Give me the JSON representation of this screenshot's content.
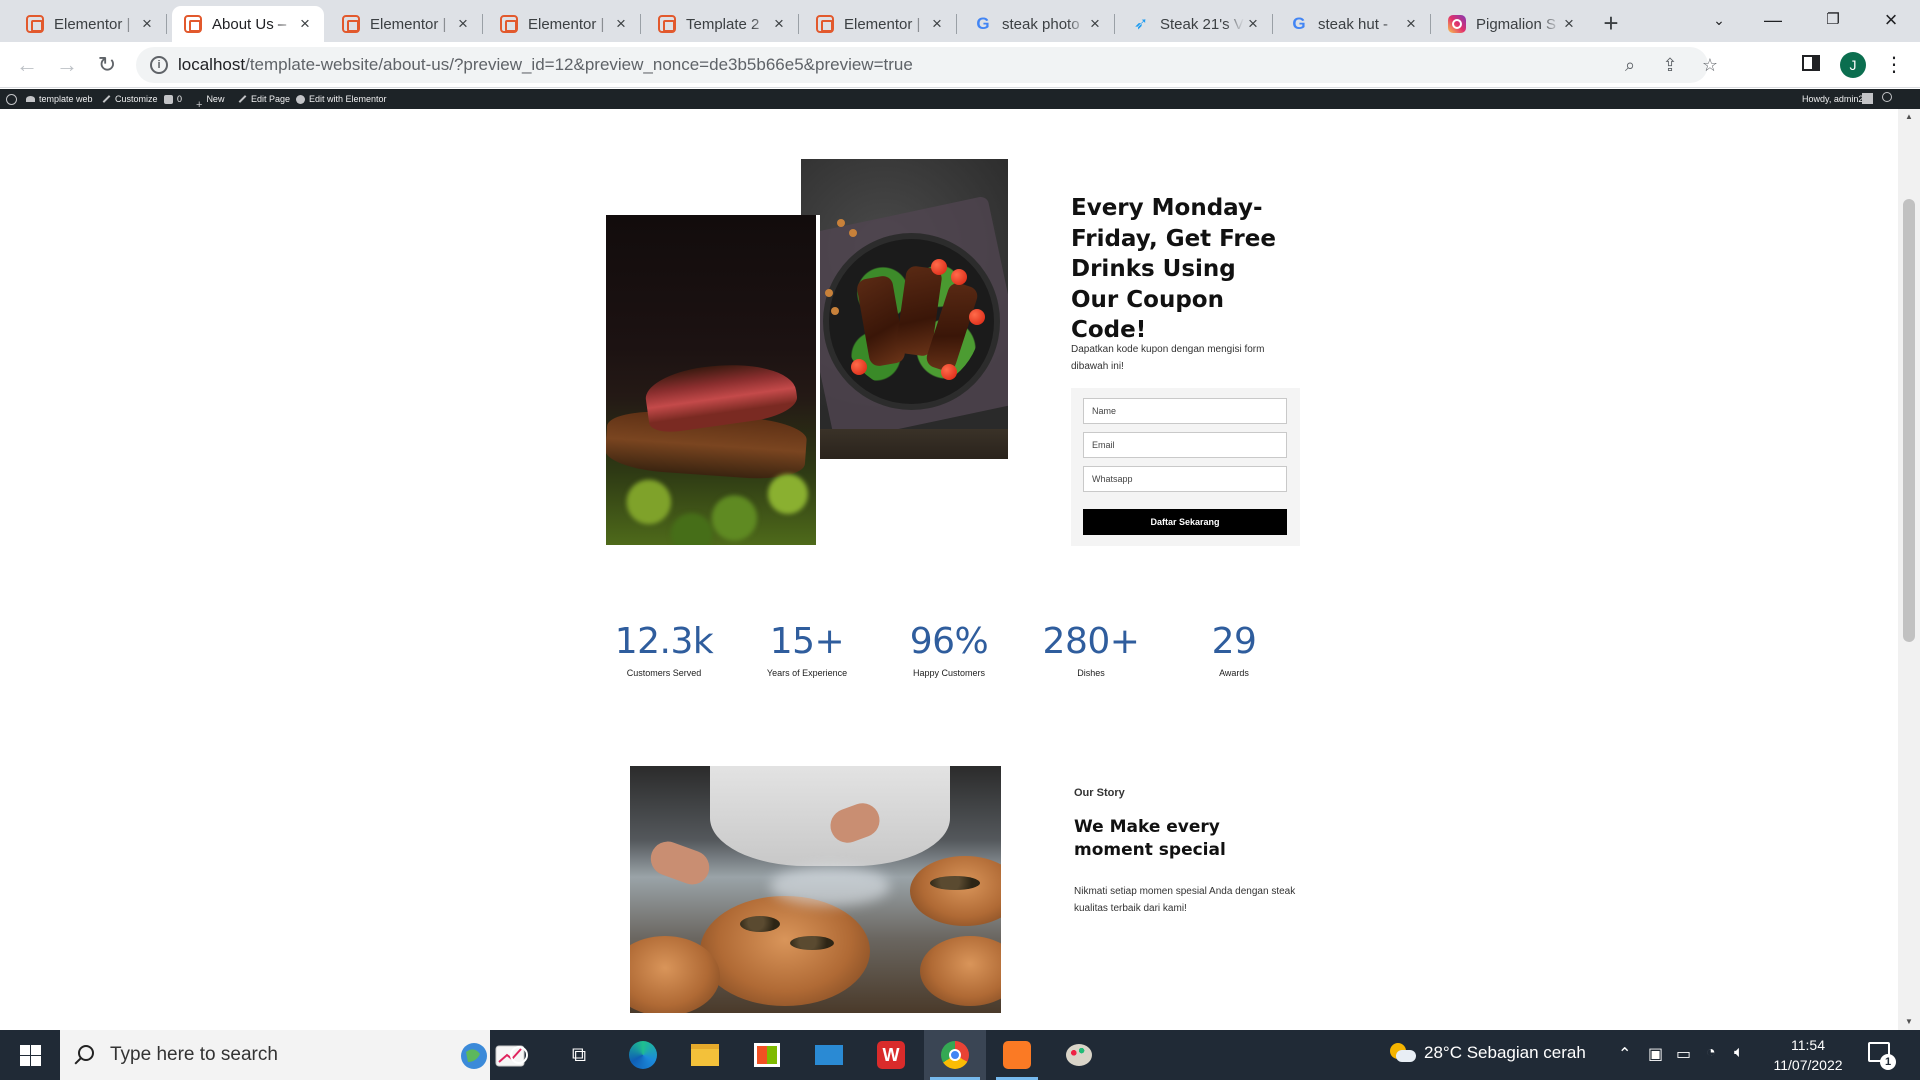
{
  "browser": {
    "tabs": [
      {
        "title": "Elementor | ",
        "icon": "elementor-icon",
        "active": false
      },
      {
        "title": "About Us – ",
        "icon": "elementor-icon",
        "active": true
      },
      {
        "title": "Elementor | ",
        "icon": "elementor-icon",
        "active": false
      },
      {
        "title": "Elementor | ",
        "icon": "elementor-icon",
        "active": false
      },
      {
        "title": "Template 2 ",
        "icon": "elementor-icon",
        "active": false
      },
      {
        "title": "Elementor | ",
        "icon": "elementor-icon",
        "active": false
      },
      {
        "title": "steak photo",
        "icon": "google-icon",
        "active": false
      },
      {
        "title": "Steak 21's V",
        "icon": "bird-icon",
        "active": false
      },
      {
        "title": "steak hut - ",
        "icon": "google-icon",
        "active": false
      },
      {
        "title": "Pigmalion S",
        "icon": "instagram-icon",
        "active": false
      }
    ],
    "url": {
      "host": "localhost",
      "path": "/template-website/about-us/?preview_id=12&preview_nonce=de3b5b66e5&preview=true"
    },
    "profile_initial": "J"
  },
  "adminbar": {
    "items": [
      "template web",
      "Customize",
      "0",
      "New",
      "Edit Page",
      "Edit with Elementor"
    ],
    "howdy": "Howdy, admin2"
  },
  "promo": {
    "heading": "Every Monday-Friday, Get Free Drinks Using Our Coupon Code!",
    "subtext": "Dapatkan kode kupon dengan mengisi form dibawah ini!",
    "form": {
      "name_placeholder": "Name",
      "email_placeholder": "Email",
      "whatsapp_placeholder": "Whatsapp",
      "submit_label": "Daftar Sekarang"
    }
  },
  "stats": [
    {
      "value": "12.3k",
      "label": "Customers Served"
    },
    {
      "value": "15+",
      "label": "Years of Experience"
    },
    {
      "value": "96%",
      "label": "Happy Customers"
    },
    {
      "value": "280+",
      "label": "Dishes"
    },
    {
      "value": "29",
      "label": "Awards"
    }
  ],
  "story": {
    "kicker": "Our Story",
    "heading": "We Make every moment special",
    "text": "Nikmati setiap momen spesial Anda dengan steak kualitas terbaik dari kami!"
  },
  "taskbar": {
    "search_placeholder": "Type here to search",
    "weather": "28°C  Sebagian cerah",
    "time": "11:54",
    "date": "11/07/2022",
    "notification_count": "1"
  },
  "colors": {
    "stat_blue": "#2f5d9d",
    "button_black": "#000000",
    "adminbar": "#1d2327",
    "taskbar": "#202a36"
  }
}
